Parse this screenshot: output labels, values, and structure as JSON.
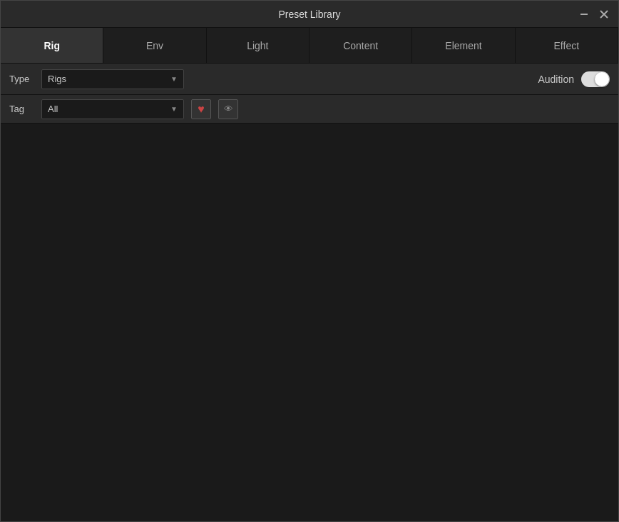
{
  "window": {
    "title": "Preset Library"
  },
  "titlebar": {
    "minimize_label": "🗕",
    "close_label": "✕"
  },
  "tabs": [
    {
      "id": "rig",
      "label": "Rig",
      "active": true
    },
    {
      "id": "env",
      "label": "Env",
      "active": false
    },
    {
      "id": "light",
      "label": "Light",
      "active": false
    },
    {
      "id": "content",
      "label": "Content",
      "active": false
    },
    {
      "id": "element",
      "label": "Element",
      "active": false
    },
    {
      "id": "effect",
      "label": "Effect",
      "active": false
    }
  ],
  "type_row": {
    "label": "Type",
    "value": "Rigs",
    "audition_label": "Audition"
  },
  "tag_row": {
    "label": "Tag",
    "value": "All",
    "favorite_icon": "♥",
    "hide_icon": "👁"
  },
  "presets": [
    {
      "id": 1,
      "class": "t1",
      "has_heart": false
    },
    {
      "id": 2,
      "class": "t2",
      "has_heart": false
    },
    {
      "id": 3,
      "class": "t3",
      "has_heart": false
    },
    {
      "id": 4,
      "class": "t4",
      "has_heart": false
    },
    {
      "id": 5,
      "class": "t5",
      "has_heart": false
    },
    {
      "id": 6,
      "class": "t6",
      "has_heart": false
    },
    {
      "id": 7,
      "class": "t7",
      "has_heart": false
    },
    {
      "id": 8,
      "class": "t8",
      "has_heart": false
    },
    {
      "id": 9,
      "class": "t9",
      "has_heart": false
    },
    {
      "id": 10,
      "class": "t10",
      "has_heart": false
    },
    {
      "id": 11,
      "class": "t11",
      "has_heart": false
    },
    {
      "id": 12,
      "class": "t12",
      "has_heart": false
    },
    {
      "id": 13,
      "class": "t13",
      "has_heart": false
    },
    {
      "id": 14,
      "class": "t14",
      "has_heart": false
    },
    {
      "id": 15,
      "class": "t15",
      "has_heart": false
    },
    {
      "id": 16,
      "class": "t16",
      "has_heart": true
    },
    {
      "id": 17,
      "class": "t17",
      "has_heart": false
    },
    {
      "id": 18,
      "class": "t18",
      "has_heart": false
    },
    {
      "id": 19,
      "class": "t19",
      "has_heart": false
    },
    {
      "id": 20,
      "class": "t20",
      "has_heart": false
    },
    {
      "id": 21,
      "class": "t21",
      "has_heart": false
    },
    {
      "id": 22,
      "class": "t22",
      "has_heart": false
    },
    {
      "id": 23,
      "class": "t23",
      "has_heart": false
    },
    {
      "id": 24,
      "class": "t24",
      "has_heart": false
    }
  ]
}
